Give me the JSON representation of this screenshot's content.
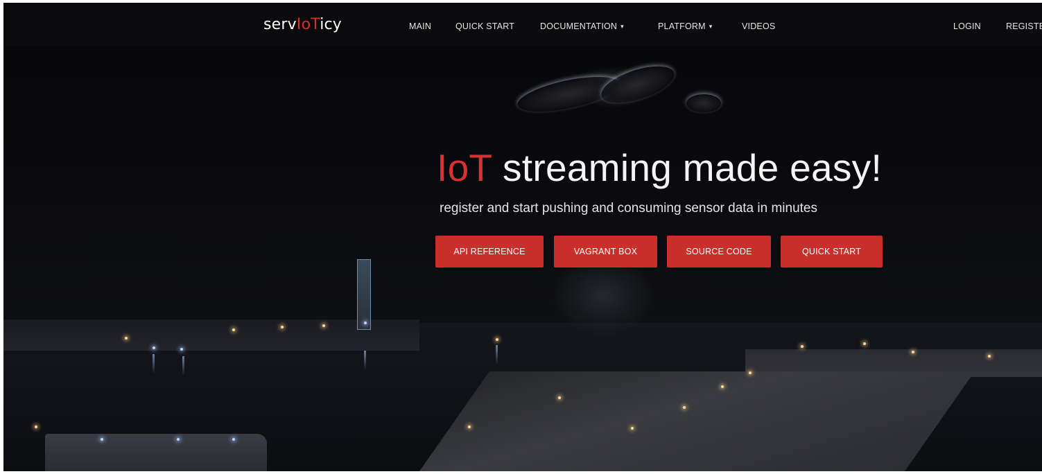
{
  "brand": {
    "prefix": "serv",
    "highlight": "IoT",
    "suffix": "icy"
  },
  "nav": {
    "items": [
      {
        "label": "MAIN"
      },
      {
        "label": "QUICK START"
      },
      {
        "label": "DOCUMENTATION",
        "has_dropdown": true
      },
      {
        "label": "PLATFORM",
        "has_dropdown": true
      },
      {
        "label": "VIDEOS"
      }
    ],
    "right": [
      {
        "label": "LOGIN"
      },
      {
        "label": "REGISTE"
      }
    ],
    "caret_glyph": "▾"
  },
  "hero": {
    "title_highlight": "IoT",
    "title_rest": " streaming made easy!",
    "subtitle": "register and start pushing and consuming sensor data in minutes",
    "buttons": [
      {
        "label": "API REFERENCE"
      },
      {
        "label": "VAGRANT BOX"
      },
      {
        "label": "SOURCE CODE"
      },
      {
        "label": "QUICK START"
      }
    ]
  },
  "colors": {
    "accent": "#d63232",
    "button": "#c9302c",
    "navbar": "#0c0c0e"
  },
  "background": "night-harbor-photo"
}
